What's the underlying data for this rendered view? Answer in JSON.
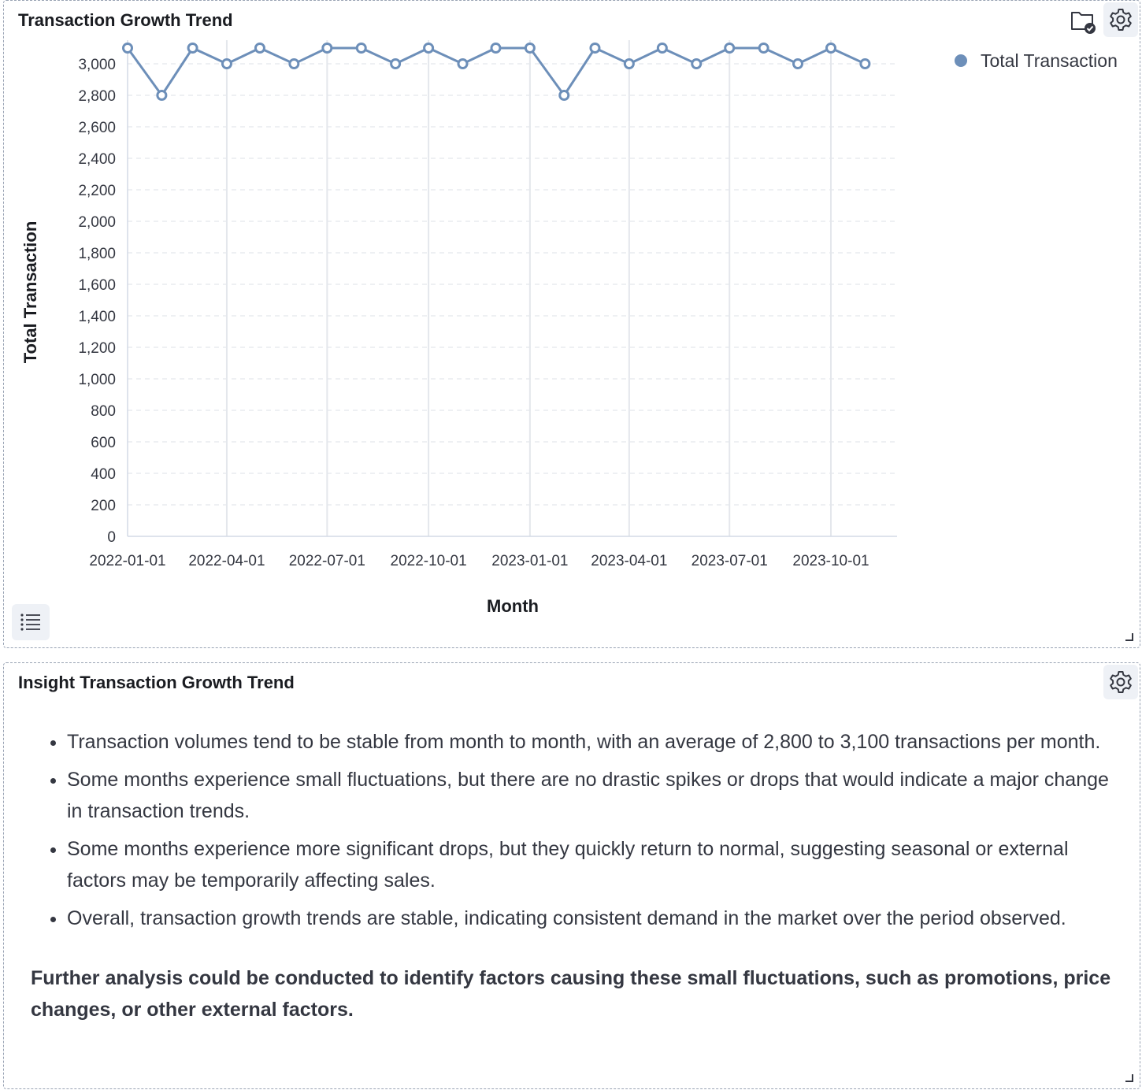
{
  "chart_panel": {
    "title": "Transaction Growth Trend",
    "folder_icon": "folder-check-icon",
    "settings_icon": "gear-icon",
    "list_icon": "list-icon"
  },
  "chart_data": {
    "type": "line",
    "title": "",
    "xlabel": "Month",
    "ylabel": "Total Transaction",
    "ylim": [
      0,
      3000
    ],
    "yticks": [
      "0",
      "200",
      "400",
      "600",
      "800",
      "1,000",
      "1,200",
      "1,400",
      "1,600",
      "1,800",
      "2,000",
      "2,200",
      "2,400",
      "2,600",
      "2,800",
      "3,000"
    ],
    "xticks": [
      "2022-01-01",
      "2022-04-01",
      "2022-07-01",
      "2022-10-01",
      "2023-01-01",
      "2023-04-01",
      "2023-07-01",
      "2023-10-01"
    ],
    "grid": true,
    "legend": "top-right",
    "series": [
      {
        "name": "Total Transaction",
        "color": "#6d8fb9",
        "x": [
          "2022-01-01",
          "2022-02-01",
          "2022-03-01",
          "2022-04-01",
          "2022-05-01",
          "2022-06-01",
          "2022-07-01",
          "2022-08-01",
          "2022-09-01",
          "2022-10-01",
          "2022-11-01",
          "2022-12-01",
          "2023-01-01",
          "2023-02-01",
          "2023-03-01",
          "2023-04-01",
          "2023-05-01",
          "2023-06-01",
          "2023-07-01",
          "2023-08-01",
          "2023-09-01",
          "2023-10-01",
          "2023-11-01"
        ],
        "values": [
          3100,
          2800,
          3100,
          3000,
          3100,
          3000,
          3100,
          3100,
          3000,
          3100,
          3000,
          3100,
          3100,
          2800,
          3100,
          3000,
          3100,
          3000,
          3100,
          3100,
          3000,
          3100,
          3000
        ]
      }
    ]
  },
  "insight_panel": {
    "title": "Insight Transaction Growth Trend",
    "settings_icon": "gear-icon",
    "bullets": [
      "Transaction volumes tend to be stable from month to month, with an average of 2,800 to 3,100 transactions per month.",
      "Some months experience small fluctuations, but there are no drastic spikes or drops that would indicate a major change in transaction trends.",
      "Some months experience more significant drops, but they quickly return to normal, suggesting seasonal or external factors may be temporarily affecting sales.",
      "Overall, transaction growth trends are stable, indicating consistent demand in the market over the period observed."
    ],
    "conclusion": "Further analysis could be conducted to identify factors causing these small fluctuations, such as promotions, price changes, or other external factors."
  }
}
